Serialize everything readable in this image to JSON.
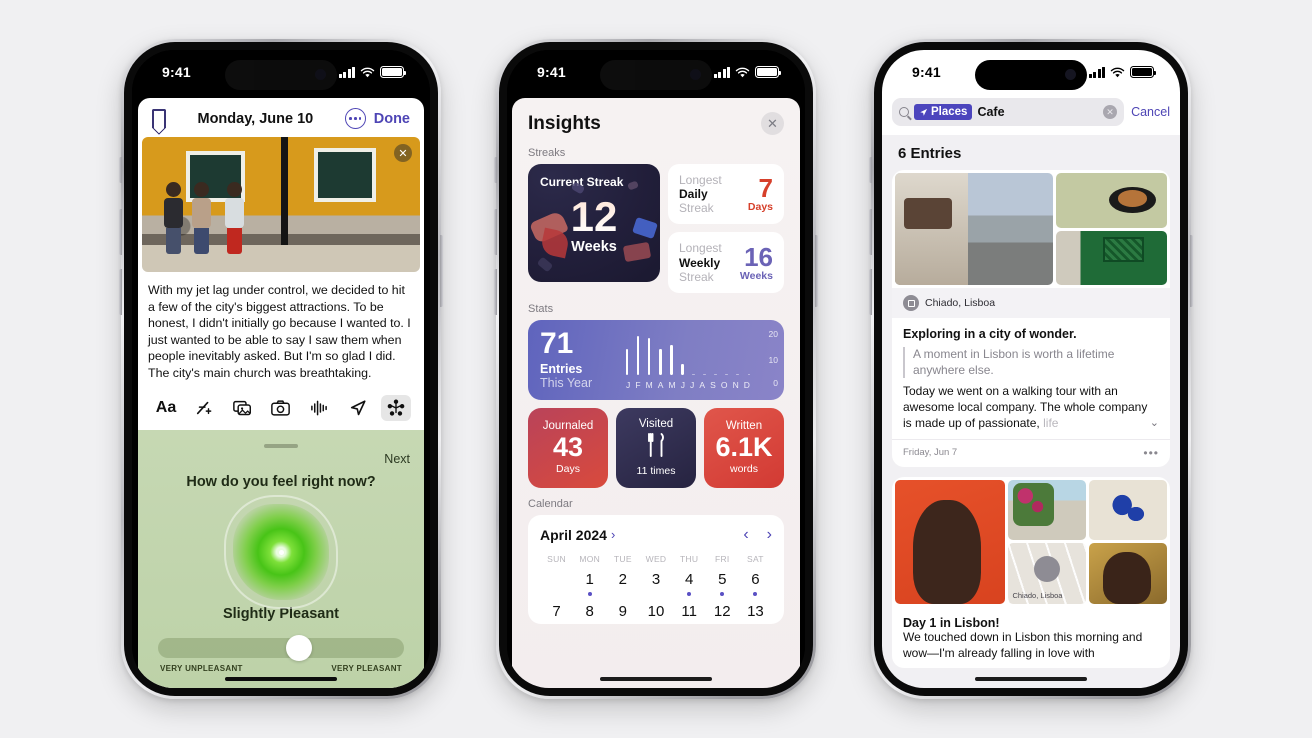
{
  "canvas": {
    "background": "#f0f0f2"
  },
  "phones": [
    {
      "id": "journal-entry",
      "status_bar": {
        "time": "9:41",
        "theme": "dark",
        "cellular_icon": "signal-bars-icon",
        "wifi_icon": "wifi-icon",
        "battery_icon": "battery-icon"
      },
      "nav": {
        "bookmark_icon": "bookmark-icon",
        "title": "Monday, June 10",
        "more_icon": "more-circle-icon",
        "done_label": "Done"
      },
      "photo": {
        "close_icon": "close-icon",
        "alt": "three people walking past a yellow building"
      },
      "entry_text": "With my jet lag under control, we decided to hit a few of the city's biggest attractions. To be honest, I didn't initially go because I wanted to. I just wanted to be able to say I saw them when people inevitably asked. But I'm so glad I did. The city's main church was breathtaking.",
      "toolbar": [
        {
          "name": "format-text-icon",
          "glyph": "Aa",
          "active": false
        },
        {
          "name": "magic-wand-icon",
          "glyph": "✨",
          "active": false
        },
        {
          "name": "photo-library-icon",
          "glyph": "▧",
          "active": false
        },
        {
          "name": "camera-icon",
          "glyph": "◎",
          "active": false
        },
        {
          "name": "audio-waveform-icon",
          "glyph": "∿",
          "active": false
        },
        {
          "name": "location-arrow-icon",
          "glyph": "➤",
          "active": false
        },
        {
          "name": "state-of-mind-icon",
          "glyph": "✻",
          "active": true
        }
      ],
      "mood": {
        "next_label": "Next",
        "question": "How do you feel right now?",
        "value_label": "Slightly Pleasant",
        "slider_position_percent": 56,
        "scale_min_label": "VERY UNPLEASANT",
        "scale_max_label": "VERY PLEASANT"
      }
    },
    {
      "id": "insights",
      "status_bar": {
        "time": "9:41",
        "theme": "dark",
        "cellular_icon": "signal-bars-icon",
        "wifi_icon": "wifi-icon",
        "battery_icon": "battery-icon"
      },
      "header": {
        "title": "Insights",
        "close_icon": "close-icon"
      },
      "streaks": {
        "section_label": "Streaks",
        "current": {
          "title": "Current Streak",
          "value": "12",
          "unit": "Weeks"
        },
        "longest_daily": {
          "line1": "Longest",
          "line2": "Daily",
          "line3": "Streak",
          "value": "7",
          "unit": "Days",
          "color": "#d6402b"
        },
        "longest_weekly": {
          "line1": "Longest",
          "line2": "Weekly",
          "line3": "Streak",
          "value": "16",
          "unit": "Weeks",
          "color": "#6b63b6"
        }
      },
      "stats": {
        "section_label": "Stats",
        "entries": {
          "value": "71",
          "line1": "Entries",
          "line2": "This Year"
        },
        "cards": [
          {
            "header": "Journaled",
            "value": "43",
            "footer": "Days",
            "color": "#d94a3c"
          },
          {
            "header": "Visited",
            "value": "🍴",
            "footer": "11 times",
            "color": "#2a2745"
          },
          {
            "header": "Written",
            "value": "6.1K",
            "footer": "words",
            "color": "#d94a3c"
          }
        ]
      },
      "calendar": {
        "section_label": "Calendar",
        "month_label": "April 2024",
        "month_chevron": "chevron-right-icon",
        "prev_icon": "chevron-left-icon",
        "next_icon": "chevron-right-icon",
        "day_headers": [
          "SUN",
          "MON",
          "TUE",
          "WED",
          "THU",
          "FRI",
          "SAT"
        ],
        "week1": [
          "",
          "1",
          "2",
          "3",
          "4",
          "5",
          "6"
        ],
        "week1_dots": [
          false,
          true,
          false,
          false,
          true,
          true,
          true
        ],
        "week2": [
          "7",
          "8",
          "9",
          "10",
          "11",
          "12",
          "13"
        ]
      },
      "chart_data": {
        "type": "bar",
        "title": "Entries This Year",
        "categories": [
          "J",
          "F",
          "M",
          "A",
          "M",
          "J",
          "J",
          "A",
          "S",
          "O",
          "N",
          "D"
        ],
        "values": [
          12,
          18,
          17,
          12,
          14,
          5,
          0,
          0,
          0,
          0,
          0,
          0
        ],
        "ytick_labels": [
          "20",
          "10",
          "0"
        ],
        "ylim": [
          0,
          20
        ],
        "xlabel": "",
        "ylabel": "",
        "legend": "none",
        "grid": false,
        "total_label": "71"
      }
    },
    {
      "id": "search-results",
      "status_bar": {
        "time": "9:41",
        "theme": "light",
        "cellular_icon": "signal-bars-icon",
        "wifi_icon": "wifi-icon",
        "battery_icon": "battery-icon"
      },
      "search": {
        "search_icon": "search-icon",
        "token_icon": "location-arrow-icon",
        "token_label": "Places",
        "value": "Cafe",
        "placeholder": "Search",
        "clear_icon": "clear-field-icon",
        "cancel_label": "Cancel"
      },
      "results_count": "6 Entries",
      "entries": [
        {
          "place": "Chiado, Lisboa",
          "place_icon": "map-pin-icon",
          "title": "Exploring in a city of wonder.",
          "quote": "A moment in Lisbon is worth a lifetime anywhere else.",
          "body": "Today we went on a walking tour with an awesome local company. The whole company is made up of passionate,",
          "body_fade": "life",
          "expand_icon": "chevron-down-icon",
          "date": "Friday, Jun 7",
          "more_icon": "more-horizontal-icon"
        },
        {
          "map_caption": "Chiado, Lisboa",
          "title": "Day 1 in Lisbon!",
          "body": "We touched down in Lisbon this morning and wow—I'm already falling in love with"
        }
      ]
    }
  ]
}
